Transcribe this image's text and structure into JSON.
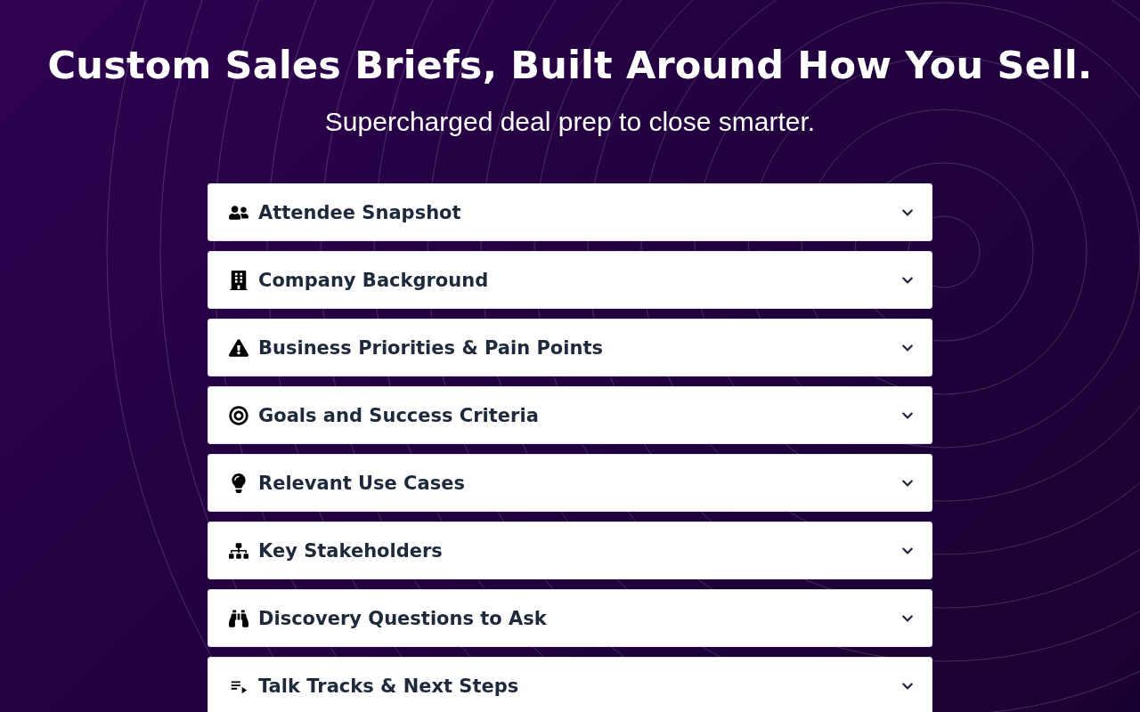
{
  "hero": {
    "title": "Custom Sales Briefs, Built Around How You Sell.",
    "subtitle": "Supercharged deal prep to close smarter."
  },
  "sections": [
    {
      "kind": "people",
      "label": "Attendee Snapshot",
      "expanded": false
    },
    {
      "kind": "building",
      "label": "Company Background",
      "expanded": false
    },
    {
      "kind": "warning",
      "label": "Business Priorities & Pain Points",
      "expanded": false
    },
    {
      "kind": "target",
      "label": "Goals and Success Criteria",
      "expanded": false
    },
    {
      "kind": "bulb",
      "label": "Relevant Use Cases",
      "expanded": false
    },
    {
      "kind": "hierarchy",
      "label": "Key Stakeholders",
      "expanded": false
    },
    {
      "kind": "binoculars",
      "label": "Discovery Questions to Ask",
      "expanded": false
    },
    {
      "kind": "playlist",
      "label": "Talk Tracks & Next Steps",
      "expanded": false
    }
  ]
}
